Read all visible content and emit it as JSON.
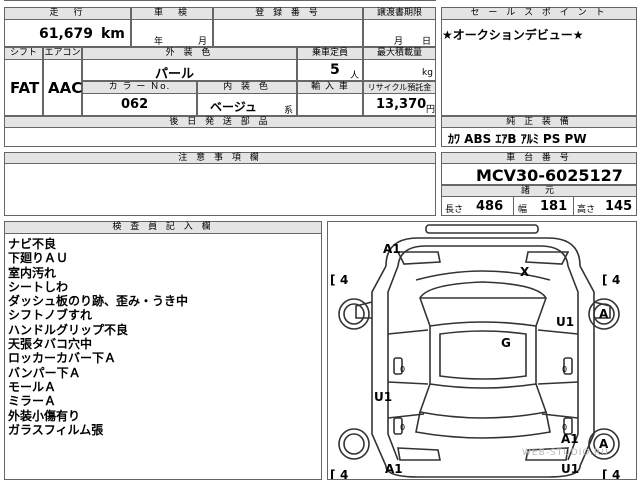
{
  "top_left": {
    "mileage_label": "走　行",
    "shaken_label": "車　検",
    "reg_label": "登 録 番 号",
    "transfer_label": "譲渡書期限",
    "mileage": "61,679",
    "km": "km",
    "year": "年",
    "month": "月",
    "month2": "月",
    "day": "日"
  },
  "row2": {
    "shift_label": "シフト",
    "ac_label": "エアコン",
    "ext_color_label": "外 装 色",
    "capacity_label": "乗車定員",
    "max_load_label": "最大積載量",
    "shift": "FAT",
    "ac": "AAC",
    "ext_color": "パール",
    "capacity": "5",
    "capacity_unit": "人",
    "kg": "kg",
    "color_no_label": "カ ラ ー  Ｎo.",
    "int_color_label": "内 装 色",
    "import_label": "輸 入 車",
    "recycle_label": "リサイクル預託金",
    "color_no": "062",
    "int_color": "ベージュ",
    "int_suffix": "系",
    "recycle": "13,370",
    "yen": "円"
  },
  "later_parts_label": "後 日 発 送 部 品",
  "caution_label": "注 意 事 項 欄",
  "sales": {
    "label": "セ ー ル ス ポ イ ン ト",
    "text": "★オークションデビュー★"
  },
  "equipment": {
    "label": "純 正 装 備",
    "text": "ｶﾜ ABS ｴｱB ｱﾙﾐ PS PW"
  },
  "chassis": {
    "label": "車 台 番 号",
    "number": "MCV30-6025127",
    "dims_label": "諸　元",
    "length_label": "長さ",
    "length": "486",
    "width_label": "幅",
    "width": "181",
    "height_label": "高さ",
    "height": "145"
  },
  "inspector": {
    "label": "検 査 員 記 入 欄",
    "notes": [
      "ナビ不良",
      "下廻りＡＵ",
      "室内汚れ",
      "シートしわ",
      "ダッシュ板のり跡、歪み・うき中",
      "シフトノブすれ",
      "ハンドルグリップ不良",
      "天張タバコ穴中",
      "ロッカーカバー下Ａ",
      "バンパー下Ａ",
      "モールＡ",
      "ミラーＡ",
      "外装小傷有り",
      "ガラスフィルム張"
    ]
  },
  "diagram": {
    "tire_label": "4",
    "marks": {
      "front_left": "A1",
      "roof_x": "X",
      "right_front_u": "U1",
      "right_front_a": "A",
      "glass_g": "G",
      "left_u": "U1",
      "right_rear_a1": "A1",
      "right_rear_a": "A",
      "right_rear_u": "U1",
      "rear_left": "A1",
      "zero": "0"
    }
  },
  "watermark": "WEB-STUDIO.RU"
}
